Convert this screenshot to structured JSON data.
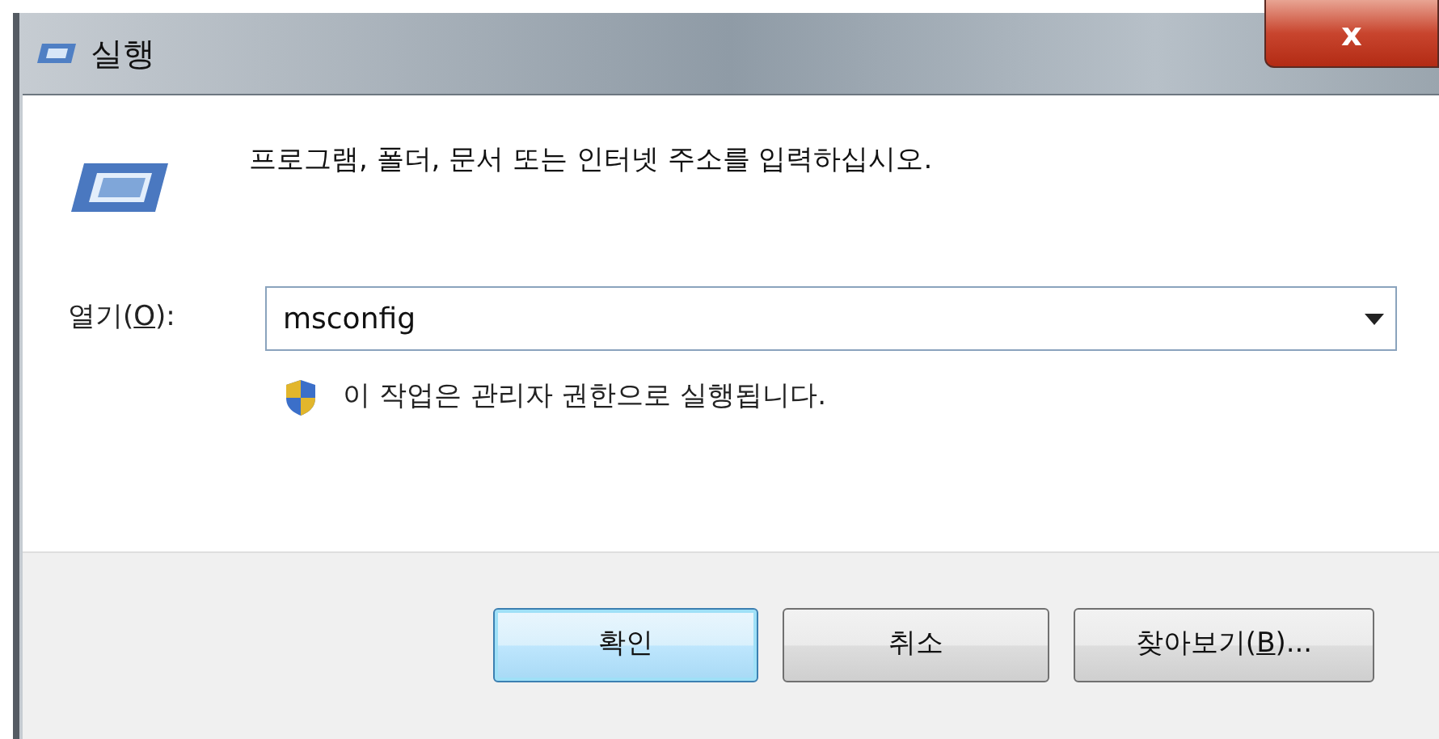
{
  "window": {
    "title": "실행",
    "close": "x"
  },
  "prompt": "프로그램, 폴더, 문서 또는 인터넷 주소를 입력하십시오.",
  "open_field": {
    "label": {
      "before": "열기(",
      "access_key": "O",
      "after": "):"
    },
    "value": "msconfig"
  },
  "admin_note": "이 작업은 관리자 권한으로 실행됩니다.",
  "buttons": [
    {
      "label": {
        "before": "확인"
      },
      "default": true
    },
    {
      "label": {
        "before": "취소"
      },
      "default": false
    },
    {
      "label": {
        "before": "찾아보기(",
        "access_key": "B",
        "after": ")..."
      },
      "default": false
    }
  ]
}
